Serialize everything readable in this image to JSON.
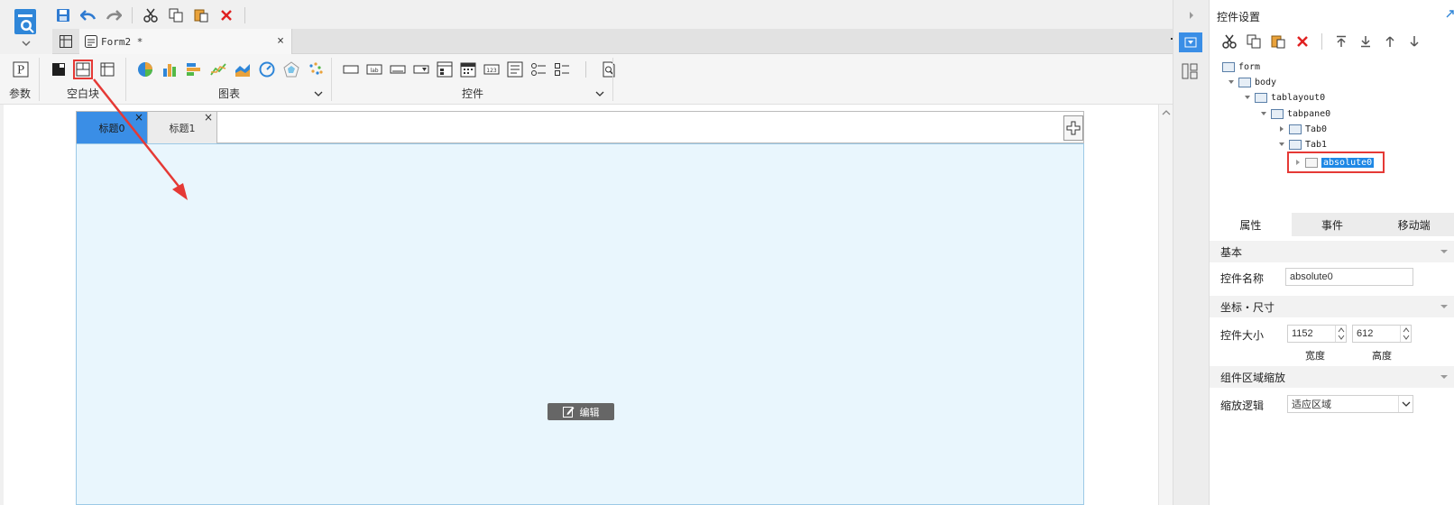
{
  "quick_toolbar": {
    "icons": [
      "save-icon",
      "undo-icon",
      "redo-icon",
      "cut-icon",
      "copy-icon",
      "paste-icon",
      "delete-icon"
    ]
  },
  "file_tab": {
    "title": "Form2 *",
    "close": "×"
  },
  "ribbon": {
    "param": {
      "label": "参数",
      "icon_glyph": "P"
    },
    "blank": {
      "label": "空白块"
    },
    "chart": {
      "label": "图表"
    },
    "widget": {
      "label": "控件"
    }
  },
  "canvas": {
    "tabs": [
      {
        "label": "标题0",
        "close": "×"
      },
      {
        "label": "标题1",
        "close": "×"
      }
    ],
    "edit_label": "编辑"
  },
  "right_panel": {
    "title": "控件设置",
    "tree": [
      {
        "label": "form"
      },
      {
        "label": "body"
      },
      {
        "label": "tablayout0"
      },
      {
        "label": "tabpane0"
      },
      {
        "label": "Tab0"
      },
      {
        "label": "Tab1"
      },
      {
        "label": "absolute0"
      }
    ],
    "prop_tabs": [
      "属性",
      "事件",
      "移动端"
    ],
    "sections": {
      "basic": "基本",
      "coords": "坐标・尺寸",
      "scale": "组件区域缩放"
    },
    "name_label": "控件名称",
    "name_value": "absolute0",
    "size_label": "控件大小",
    "width_value": "1152",
    "height_value": "612",
    "width_label": "宽度",
    "height_label": "高度",
    "scale_label": "缩放逻辑",
    "scale_value": "适应区域"
  },
  "colors": {
    "accent": "#1e88e5",
    "tab_active": "#3a8ee6",
    "canvas_bg": "#e9f6fd",
    "highlight_red": "#e53935"
  }
}
